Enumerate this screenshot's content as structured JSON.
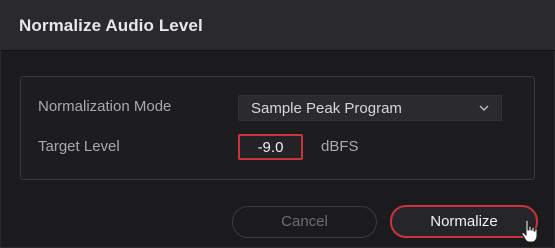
{
  "dialog": {
    "title": "Normalize Audio Level"
  },
  "form": {
    "mode_label": "Normalization Mode",
    "mode_value": "Sample Peak Program",
    "target_label": "Target Level",
    "target_value": "-9.0",
    "target_unit": "dBFS"
  },
  "buttons": {
    "cancel_label": "Cancel",
    "normalize_label": "Normalize"
  },
  "icons": {
    "dropdown": "chevron-down-icon",
    "pointer": "mouse-pointer-icon"
  },
  "colors": {
    "accent_red": "#c9343e",
    "background": "#1b1b1d",
    "titlebar": "#2a2a2e"
  }
}
